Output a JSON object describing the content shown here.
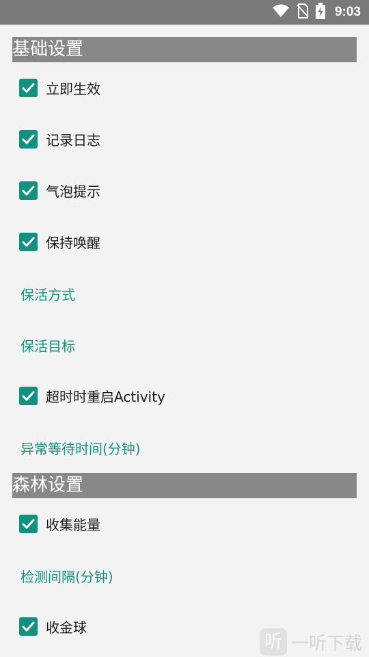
{
  "status_bar": {
    "time": "9:03",
    "icons": [
      "wifi-icon",
      "no-sim-icon",
      "battery-charging-icon"
    ]
  },
  "sections": {
    "basic": {
      "title": "基础设置",
      "items": [
        {
          "type": "checkbox",
          "label": "立即生效",
          "checked": true
        },
        {
          "type": "checkbox",
          "label": "记录日志",
          "checked": true
        },
        {
          "type": "checkbox",
          "label": "气泡提示",
          "checked": true
        },
        {
          "type": "checkbox",
          "label": "保持唤醒",
          "checked": true
        },
        {
          "type": "link",
          "label": "保活方式"
        },
        {
          "type": "link",
          "label": "保活目标"
        },
        {
          "type": "checkbox",
          "label": "超时时重启Activity",
          "checked": true
        },
        {
          "type": "link",
          "label": "异常等待时间(分钟)"
        }
      ]
    },
    "forest": {
      "title": "森林设置",
      "items": [
        {
          "type": "checkbox",
          "label": "收集能量",
          "checked": true
        },
        {
          "type": "link",
          "label": "检测间隔(分钟)"
        },
        {
          "type": "checkbox",
          "label": "收金球",
          "checked": true
        }
      ]
    }
  },
  "watermark": {
    "logo_glyph": "听",
    "text": "一听下载"
  },
  "colors": {
    "accent": "#16907e",
    "header_bg": "#888888",
    "status_bar_bg": "#7a7a7a",
    "page_bg": "#f3f3f3"
  }
}
